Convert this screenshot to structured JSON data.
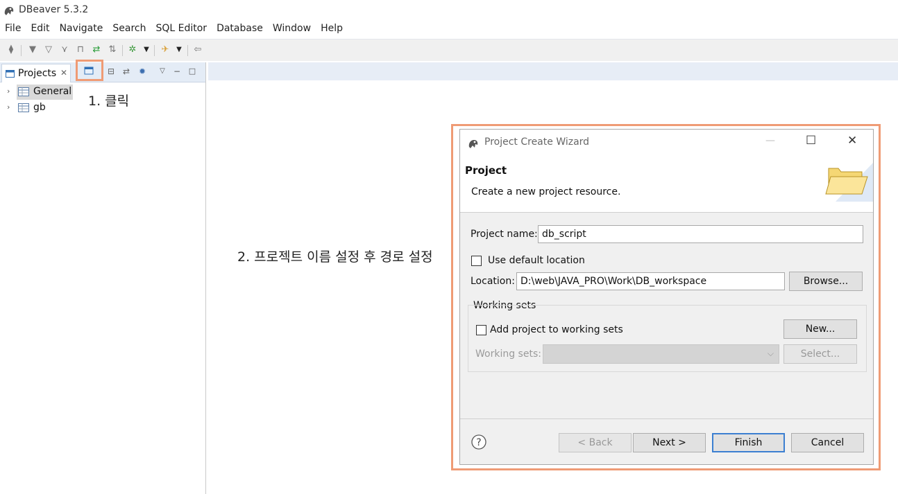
{
  "app": {
    "title": "DBeaver 5.3.2"
  },
  "menu": [
    "File",
    "Edit",
    "Navigate",
    "Search",
    "SQL Editor",
    "Database",
    "Window",
    "Help"
  ],
  "projects_view": {
    "tab_label": "Projects",
    "tree": [
      {
        "label": "General",
        "selected": true
      },
      {
        "label": "gb",
        "selected": false
      }
    ]
  },
  "annotations": {
    "step1": "1. 클릭",
    "step2": "2. 프로젝트 이름 설정 후 경로 설정"
  },
  "wizard": {
    "window_title": "Project Create Wizard",
    "heading": "Project",
    "description": "Create a new project resource.",
    "project_name_label": "Project name:",
    "project_name_value": "db_script",
    "use_default_location_label": "Use default location",
    "use_default_location_checked": false,
    "location_label": "Location:",
    "location_value": "D:\\web\\JAVA_PRO\\Work\\DB_workspace",
    "browse_label": "Browse...",
    "working_sets_group": "Working sets",
    "add_to_working_sets_label": "Add project to working sets",
    "add_to_working_sets_checked": false,
    "new_label": "New...",
    "working_sets_label": "Working sets:",
    "working_sets_value": "",
    "select_label": "Select...",
    "buttons": {
      "back": "< Back",
      "next": "Next >",
      "finish": "Finish",
      "cancel": "Cancel"
    }
  },
  "colors": {
    "highlight": "#ef9b75",
    "default_button_border": "#3b7fd1",
    "panel_header": "#e4ecf6"
  }
}
